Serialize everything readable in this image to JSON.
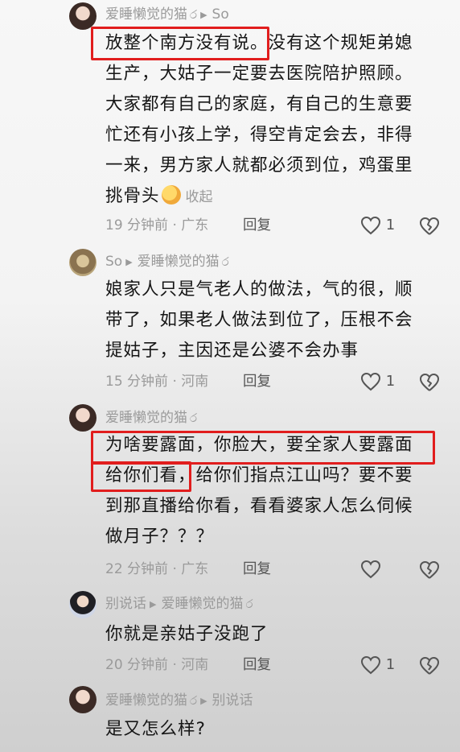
{
  "comments": [
    {
      "author": "爱睡懒觉的猫",
      "reply_to": "So",
      "text_lines": [
        "放整个南方没有说。没有这个规矩弟媳",
        "生产，大姑子一定要去医院陪护照顾。",
        "大家都有自己的家庭，有自己的生意要",
        "忙还有小孩上学，得空肯定会去，非得",
        "一来，男方家人就都必须到位，鸡蛋里",
        "挑骨头"
      ],
      "collapse": "收起",
      "time_location": "19 分钟前 · 广东",
      "reply_label": "回复",
      "likes": "1"
    },
    {
      "author": "So",
      "reply_to": "爱睡懒觉的猫",
      "text_lines": [
        "娘家人只是气老人的做法，气的很，顺",
        "带了，如果老人做法到位了，压根不会",
        "提姑子，主因还是公婆不会办事"
      ],
      "time_location": "15 分钟前 · 河南",
      "reply_label": "回复",
      "likes": "1"
    },
    {
      "author": "爱睡懒觉的猫",
      "reply_to": "",
      "text_lines": [
        "为啥要露面，你脸大，要全家人要露面",
        "给你们看，给你们指点江山吗？要不要",
        "到那直播给你看，看看婆家人怎么伺候",
        "做月子？？？"
      ],
      "time_location": "22 分钟前 · 广东",
      "reply_label": "回复",
      "likes": ""
    },
    {
      "author": "别说话",
      "reply_to": "爱睡懒觉的猫",
      "text_lines": [
        "你就是亲姑子没跑了"
      ],
      "time_location": "20 分钟前 · 河南",
      "reply_label": "回复",
      "likes": "1"
    },
    {
      "author": "爱睡懒觉的猫",
      "reply_to": "别说话",
      "text_lines": [
        "是又怎么样?"
      ]
    }
  ],
  "icons": {
    "author_mark": "ර",
    "reply_arrow": "▶",
    "like": "heart-icon",
    "dislike": "broken-heart-icon"
  },
  "colors": {
    "highlight": "#e11d1d",
    "meta": "#9a9a9a"
  }
}
